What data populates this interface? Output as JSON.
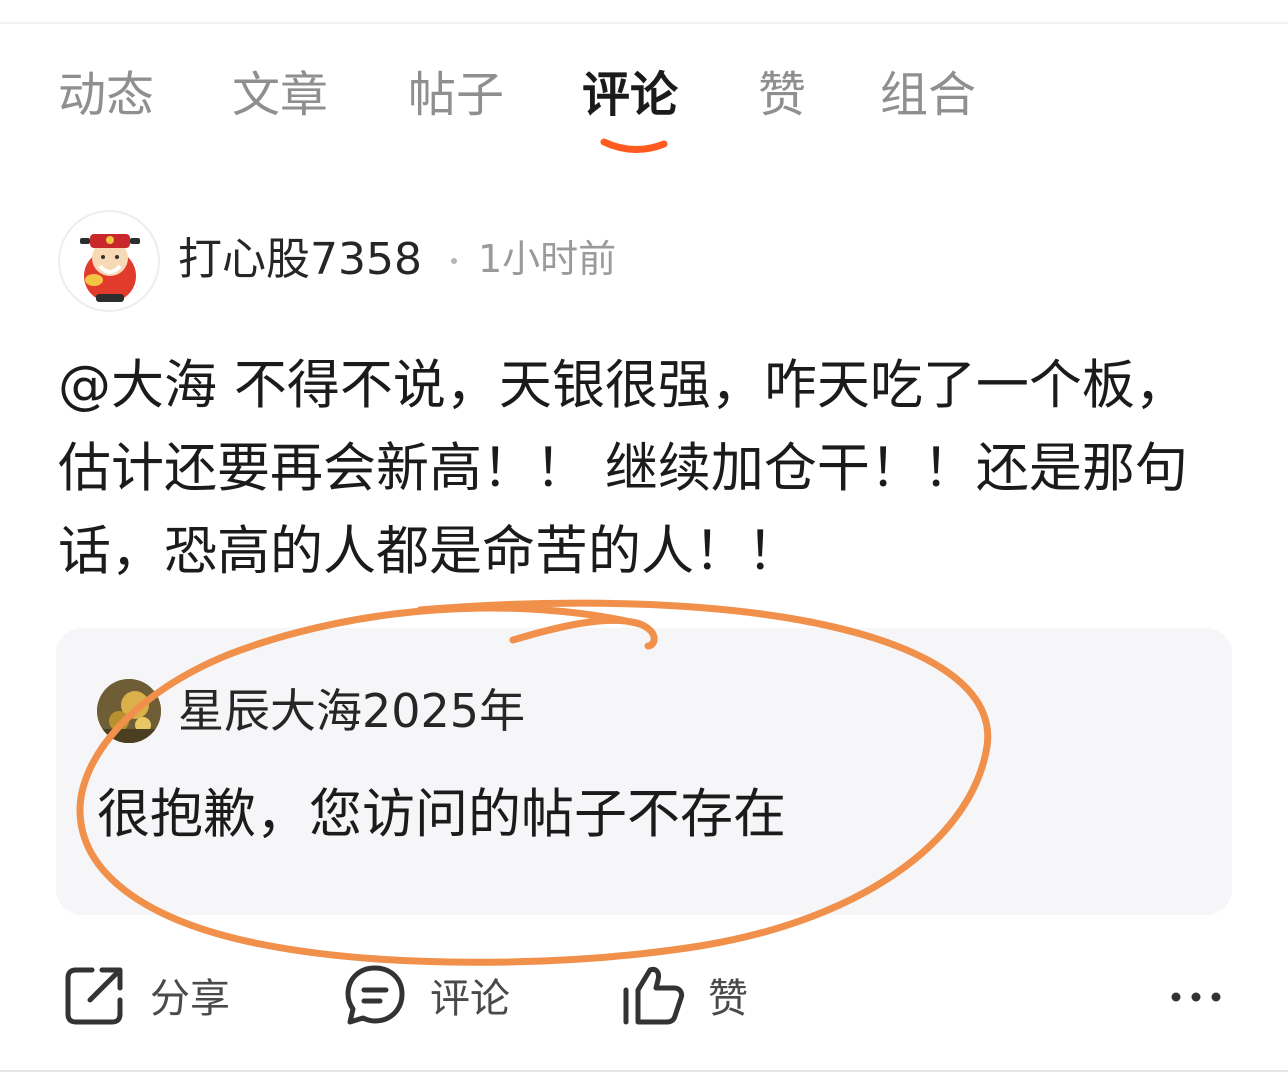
{
  "tabs": [
    {
      "label": "动态",
      "active": false
    },
    {
      "label": "文章",
      "active": false
    },
    {
      "label": "帖子",
      "active": false
    },
    {
      "label": "评论",
      "active": true
    },
    {
      "label": "赞",
      "active": false
    },
    {
      "label": "组合",
      "active": false
    }
  ],
  "comment": {
    "author": "打心股7358",
    "time": "1小时前",
    "body": "@大海 不得不说，天银很强，咋天吃了一个板，估计还要再会新高！！ 继续加仓干！！还是那句话，恐高的人都是命苦的人！！"
  },
  "quote": {
    "author": "星辰大海2025年",
    "text": "很抱歉，您访问的帖子不存在"
  },
  "actions": {
    "share_label": "分享",
    "comment_label": "评论",
    "like_label": "赞"
  },
  "colors": {
    "accent": "#ff5a1f",
    "annotation": "#f0904a",
    "muted_text": "#8f8f8f",
    "card_bg": "#f6f6f8"
  },
  "icons": [
    "share-icon",
    "comment-icon",
    "thumbs-up-icon",
    "more-icon"
  ]
}
